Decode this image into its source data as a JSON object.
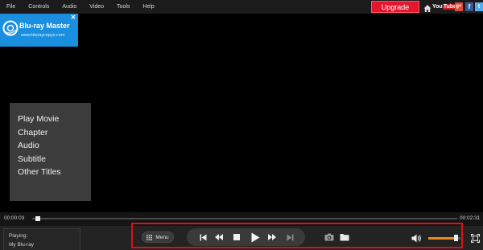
{
  "menubar": {
    "items": [
      "File",
      "Controls",
      "Audio",
      "Video",
      "Tools",
      "Help"
    ],
    "upgrade_label": "Upgrade",
    "social": {
      "youtube_you": "You",
      "youtube_tube": "Tube",
      "googleplus": "g+",
      "facebook": "f",
      "twitter": "t"
    }
  },
  "ad": {
    "title": "Blu-ray Master",
    "url": "www.bluraycopys.com",
    "close_label": "✕"
  },
  "disc_menu": {
    "items": [
      "Play Movie",
      "Chapter",
      "Audio",
      "Subtitle",
      "Other Titles"
    ]
  },
  "timeline": {
    "current_time": "00:00:03",
    "total_time": "00:02:31",
    "progress": 0.02
  },
  "now_playing": {
    "label": "Playing:",
    "title": "My Blu-ray"
  },
  "controls": {
    "menu_label": "Menu",
    "volume_level": 0.85
  },
  "colors": {
    "upgrade": "#e3162e",
    "highlight": "#e01010",
    "volume_accent": "#f08a1c",
    "ad_background": "#1a8fe0"
  },
  "icons": [
    "home-icon",
    "youtube-icon",
    "googleplus-icon",
    "facebook-icon",
    "twitter-icon",
    "disc-icon",
    "grid-icon",
    "skip-previous-icon",
    "rewind-icon",
    "stop-icon",
    "play-icon",
    "fast-forward-icon",
    "skip-next-icon",
    "camera-icon",
    "folder-icon",
    "volume-icon",
    "fullscreen-icon"
  ]
}
